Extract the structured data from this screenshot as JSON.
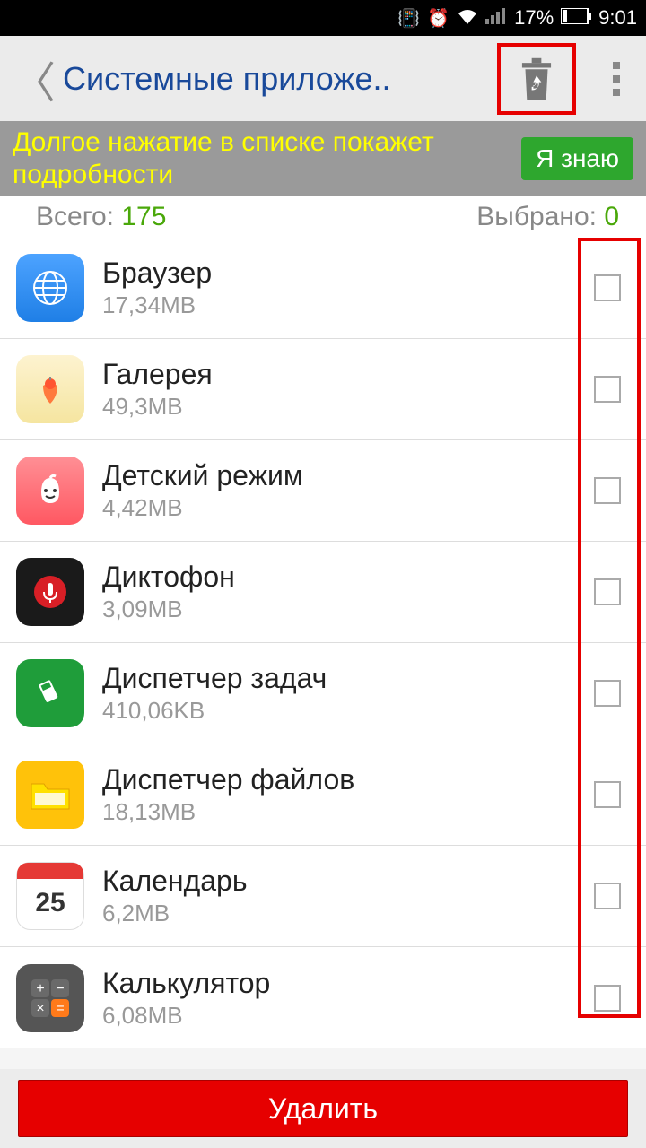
{
  "status": {
    "battery_pct": "17%",
    "time": "9:01"
  },
  "header": {
    "title": "Системные приложе.."
  },
  "hint": {
    "text": "Долгое нажатие в списке покажет подробности",
    "button": "Я знаю"
  },
  "counts": {
    "total_label": "Всего: ",
    "total_value": "175",
    "selected_label": "Выбрано: ",
    "selected_value": "0"
  },
  "apps": [
    {
      "name": "Браузер",
      "size": "17,34MB"
    },
    {
      "name": "Галерея",
      "size": "49,3MB"
    },
    {
      "name": "Детский режим",
      "size": "4,42MB"
    },
    {
      "name": "Диктофон",
      "size": "3,09MB"
    },
    {
      "name": "Диспетчер задач",
      "size": "410,06KB"
    },
    {
      "name": "Диспетчер файлов",
      "size": "18,13MB"
    },
    {
      "name": "Календарь",
      "size": "6,2MB"
    },
    {
      "name": "Калькулятор",
      "size": "6,08MB"
    }
  ],
  "footer": {
    "delete": "Удалить"
  },
  "calendar_day": "25"
}
